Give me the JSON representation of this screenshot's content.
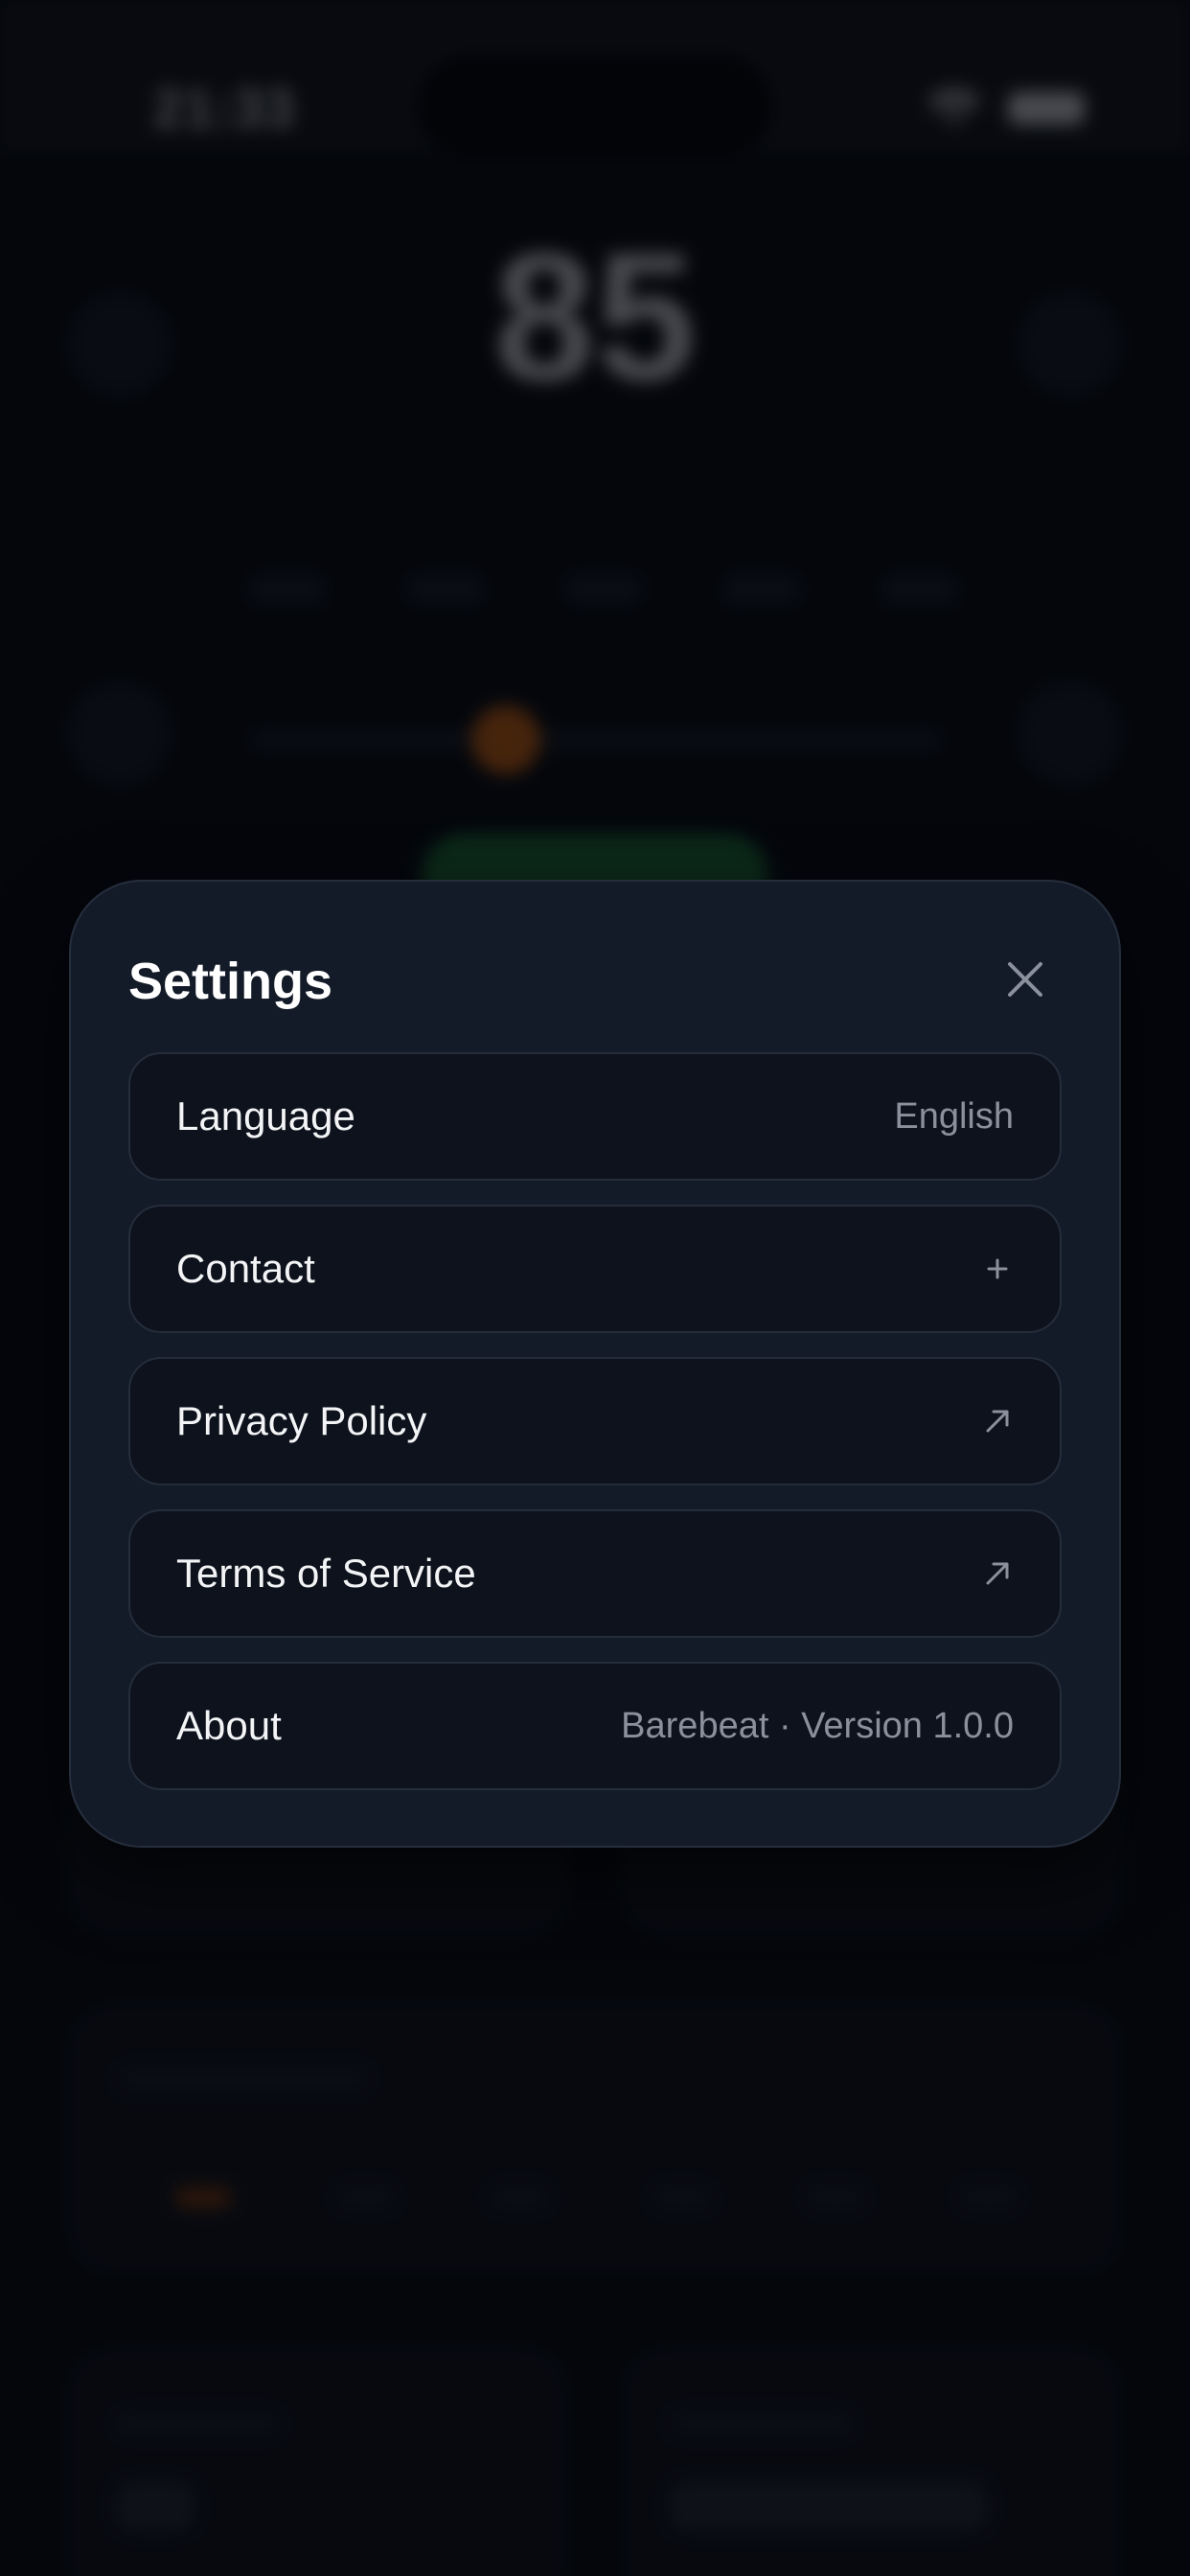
{
  "status_bar": {
    "time": "21:33",
    "wifi_icon": "wifi-icon",
    "battery_icon": "battery-icon"
  },
  "background": {
    "bpm": "85",
    "accent_color": "#e06b10",
    "start_color": "#1e7a3c"
  },
  "settings": {
    "title": "Settings",
    "close_icon": "close-icon",
    "rows": [
      {
        "label": "Language",
        "value": "English",
        "trailing": "text"
      },
      {
        "label": "Contact",
        "value": "",
        "trailing": "plus-icon"
      },
      {
        "label": "Privacy Policy",
        "value": "",
        "trailing": "arrow-up-right-icon"
      },
      {
        "label": "Terms of Service",
        "value": "",
        "trailing": "arrow-up-right-icon"
      },
      {
        "label": "About",
        "value": "Barebeat · Version 1.0.0",
        "trailing": "text"
      }
    ]
  },
  "colors": {
    "modal_background": "#131a28",
    "row_background": "#0d121d",
    "border": "#252d3b",
    "primary_text": "#ffffff",
    "secondary_text": "#8a909c"
  }
}
